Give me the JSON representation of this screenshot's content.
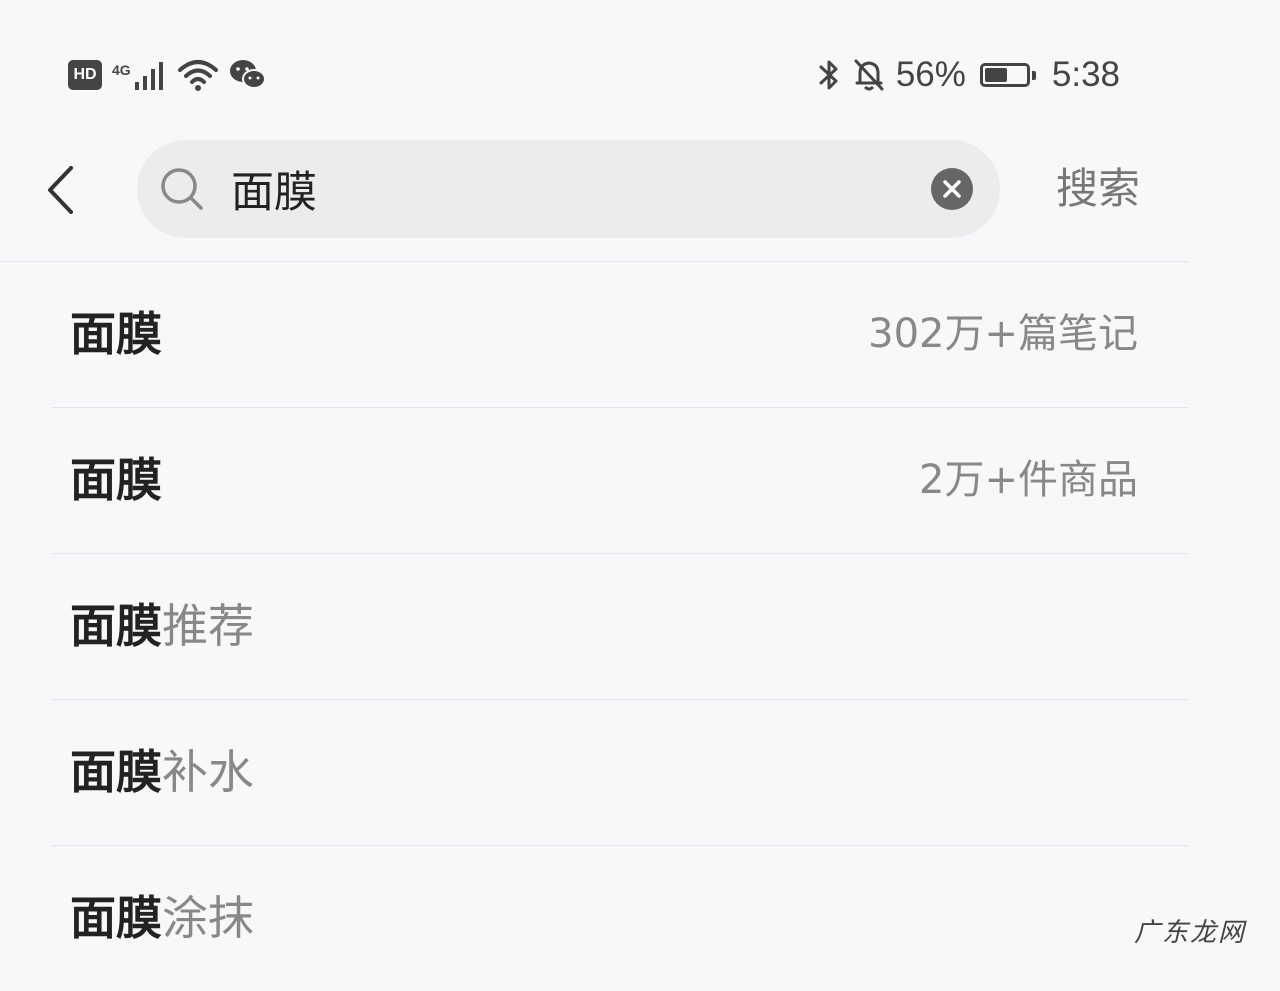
{
  "status_bar": {
    "hd_label": "HD",
    "network_type": "4G",
    "battery_percent": "56%",
    "battery_level": 0.56,
    "time": "5:38",
    "icons": [
      "signal-icon",
      "wifi-icon",
      "wechat-icon",
      "bluetooth-icon",
      "bell-muted-icon",
      "battery-icon"
    ]
  },
  "search": {
    "query": "面膜",
    "submit_label": "搜索"
  },
  "suggestions": [
    {
      "match": "面膜",
      "rest": "",
      "meta": "302万+篇笔记"
    },
    {
      "match": "面膜",
      "rest": "",
      "meta": "2万+件商品"
    },
    {
      "match": "面膜",
      "rest": "推荐",
      "meta": ""
    },
    {
      "match": "面膜",
      "rest": "补水",
      "meta": ""
    },
    {
      "match": "面膜",
      "rest": "涂抹",
      "meta": ""
    }
  ],
  "watermark": "广东龙网"
}
